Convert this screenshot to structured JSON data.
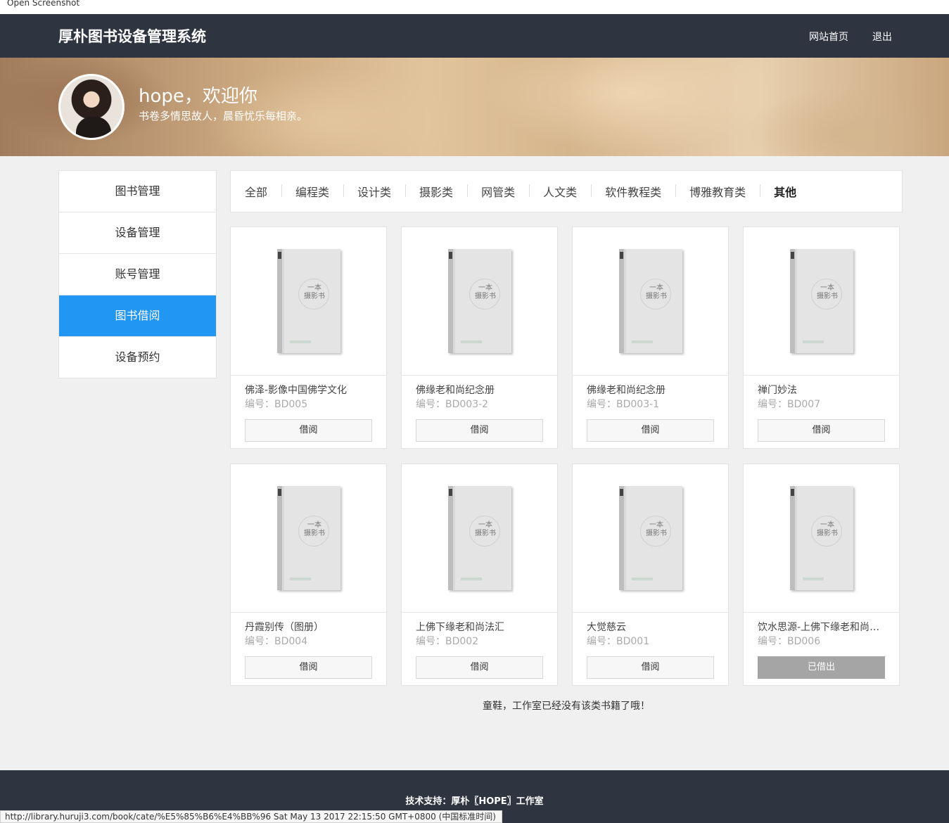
{
  "browser": {
    "top_note": "Open Screenshot",
    "status_url": "http://library.huruji3.com/book/cate/%E5%85%B6%E4%BB%96 Sat May 13 2017 22:15:50 GMT+0800 (中国标准时间)"
  },
  "header": {
    "brand": "厚朴图书设备管理系统",
    "nav": [
      "网站首页",
      "退出"
    ]
  },
  "banner": {
    "welcome": "hope，欢迎你",
    "motto": "书卷多情思故人，晨昏忧乐每相亲。"
  },
  "sidebar": {
    "items": [
      "图书管理",
      "设备管理",
      "账号管理",
      "图书借阅",
      "设备预约"
    ],
    "active_index": 3
  },
  "categories": {
    "items": [
      "全部",
      "编程类",
      "设计类",
      "摄影类",
      "网管类",
      "人文类",
      "软件教程类",
      "博雅教育类",
      "其他"
    ],
    "active_index": 8
  },
  "book_cover": {
    "title_line1": "一本",
    "title_line2": "摄影书"
  },
  "books": [
    {
      "title": "佛泽-影像中国佛学文化",
      "code": "编号：BD005",
      "action": "借阅",
      "available": true
    },
    {
      "title": "佛缘老和尚纪念册",
      "code": "编号：BD003-2",
      "action": "借阅",
      "available": true
    },
    {
      "title": "佛缘老和尚纪念册",
      "code": "编号：BD003-1",
      "action": "借阅",
      "available": true
    },
    {
      "title": "禅门妙法",
      "code": "编号：BD007",
      "action": "借阅",
      "available": true
    },
    {
      "title": "丹霞别传（图册）",
      "code": "编号：BD004",
      "action": "借阅",
      "available": true
    },
    {
      "title": "上佛下缘老和尚法汇",
      "code": "编号：BD002",
      "action": "借阅",
      "available": true
    },
    {
      "title": "大觉慈云",
      "code": "编号：BD001",
      "action": "借阅",
      "available": true
    },
    {
      "title": "饮水思源-上佛下缘老和尚行...",
      "code": "编号：BD006",
      "action": "已借出",
      "available": false
    }
  ],
  "end_note": "童鞋，工作室已经没有该类书籍了哦！",
  "footer": {
    "text": "技术支持：厚朴〖HOPE〗工作室"
  },
  "colors": {
    "header_bg": "#2e3440",
    "accent": "#2196f3",
    "borrowed_btn": "#a5a5a5"
  }
}
